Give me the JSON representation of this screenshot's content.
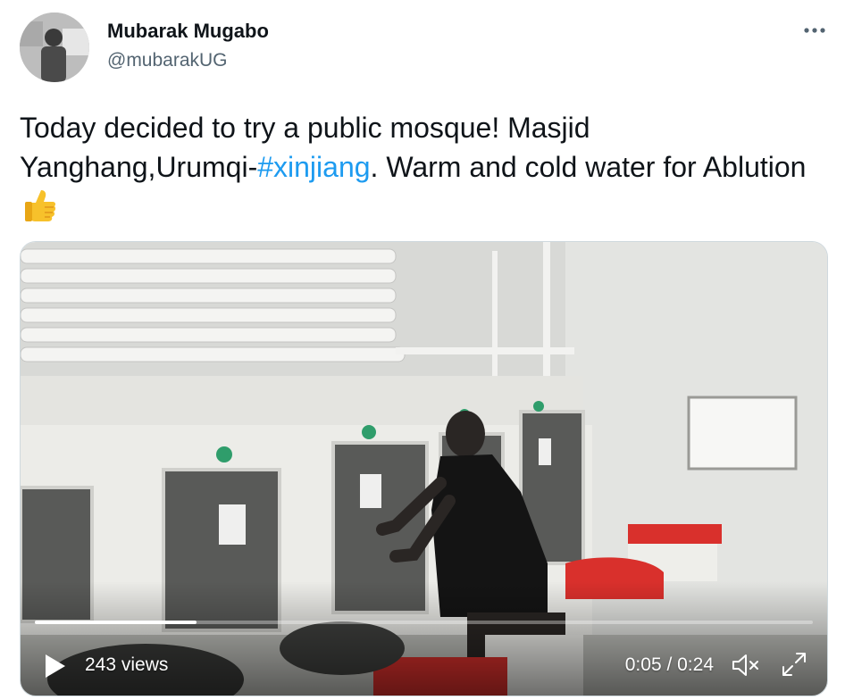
{
  "tweet": {
    "author_name": "Mubarak Mugabo",
    "author_handle": "@mubarakUG",
    "text_part1": "Today decided to try a public mosque! Masjid Yanghang,Urumqi-",
    "hashtag": "#xinjiang",
    "text_part2": ". Warm and cold water for Ablution",
    "emoji_icon": "thumbs-up-icon"
  },
  "video": {
    "views_label": "243 views",
    "time_label": "0:05 / 0:24",
    "progress": 0.208,
    "controls": {
      "play_icon": "play-icon",
      "mute_icon": "muted-speaker-icon",
      "expand_icon": "expand-icon"
    }
  },
  "colors": {
    "accent": "#1d9bf0",
    "text_primary": "#0f1419",
    "text_secondary": "#536471"
  }
}
